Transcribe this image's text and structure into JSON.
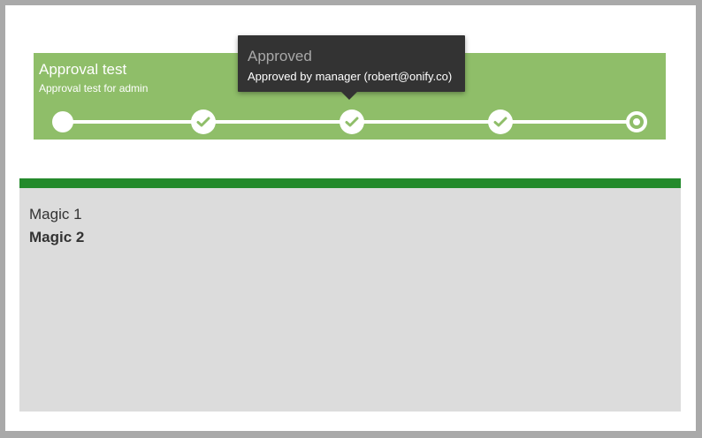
{
  "approval": {
    "title": "Approval test",
    "subtitle": "Approval test for admin",
    "steps": [
      {
        "state": "current"
      },
      {
        "state": "approved",
        "icon": "check-icon"
      },
      {
        "state": "approved",
        "icon": "check-icon"
      },
      {
        "state": "approved",
        "icon": "check-icon"
      },
      {
        "state": "pending"
      }
    ]
  },
  "tooltip": {
    "title": "Approved",
    "body": "Approved by manager (robert@onify.co)"
  },
  "panel": {
    "line1": "Magic 1",
    "line2": "Magic 2"
  },
  "colors": {
    "banner": "#8fbe69",
    "panel_header": "#248a2c",
    "panel_bg": "#dcdcdc",
    "tooltip_bg": "#333333"
  }
}
